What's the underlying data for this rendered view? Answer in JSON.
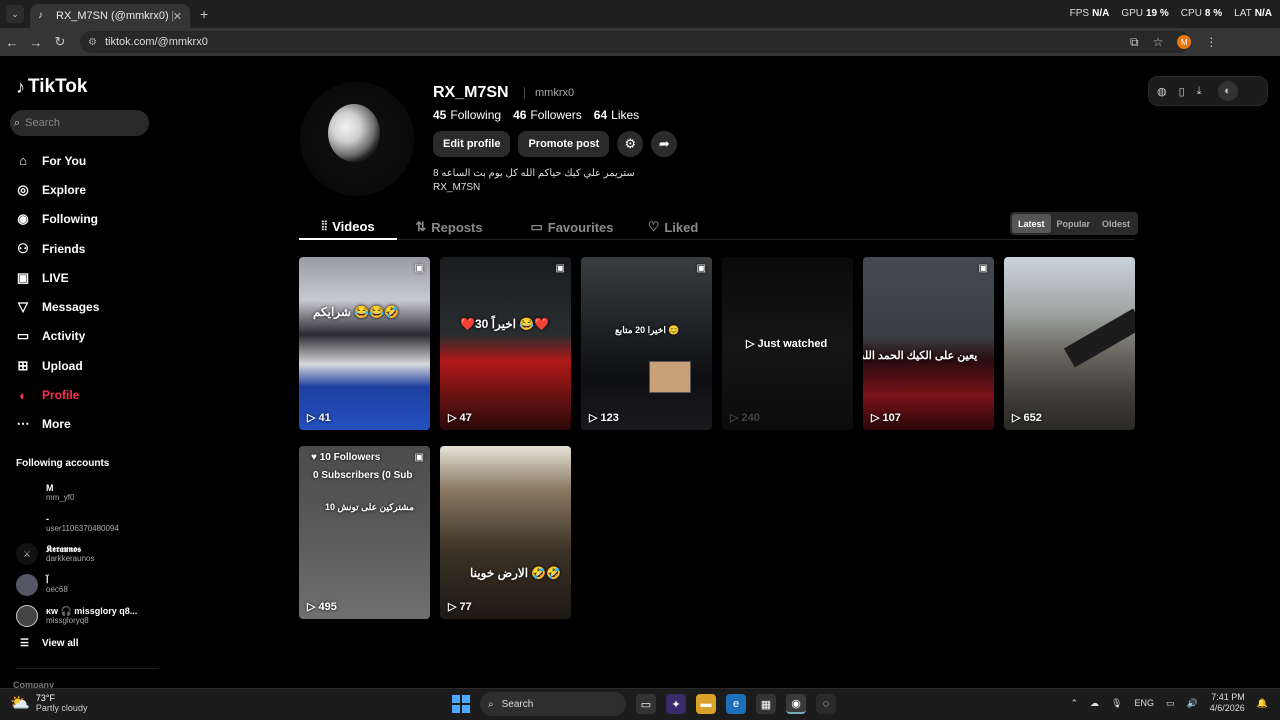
{
  "browser": {
    "tab_title": "RX_M7SN (@mmkrx0) | TikTok",
    "url": "tiktok.com/@mmkrx0",
    "profile_initial": "M",
    "perf": [
      {
        "label": "FPS",
        "value": "N/A"
      },
      {
        "label": "GPU",
        "value": "19 %"
      },
      {
        "label": "CPU",
        "value": "8 %"
      },
      {
        "label": "LAT",
        "value": "N/A"
      }
    ]
  },
  "sidebar": {
    "logo": "TikTok",
    "search_placeholder": "Search",
    "nav": [
      {
        "label": "For You",
        "icon": "home-icon"
      },
      {
        "label": "Explore",
        "icon": "compass-icon"
      },
      {
        "label": "Following",
        "icon": "following-avatar-icon"
      },
      {
        "label": "Friends",
        "icon": "friends-icon"
      },
      {
        "label": "LIVE",
        "icon": "live-icon"
      },
      {
        "label": "Messages",
        "icon": "messages-icon"
      },
      {
        "label": "Activity",
        "icon": "activity-icon"
      },
      {
        "label": "Upload",
        "icon": "upload-icon"
      },
      {
        "label": "Profile",
        "icon": "profile-icon",
        "active": true
      },
      {
        "label": "More",
        "icon": "more-icon"
      }
    ],
    "following_header": "Following accounts",
    "following": [
      {
        "name": "M",
        "handle": "mm_yf0"
      },
      {
        "name": "-",
        "handle": "user1106370480094"
      },
      {
        "name": "𝕶𝖊𝖗𝖆𝖚𝖓𝖔𝖘",
        "handle": "darkkeraunos"
      },
      {
        "name": "آ",
        "handle": "oec68"
      },
      {
        "name": "ᴋᴡ 🎧 missglory q8...",
        "handle": "missgloryq8"
      }
    ],
    "view_all": "View all",
    "company": "Company"
  },
  "profile": {
    "name": "RX_M7SN",
    "handle": "mmkrx0",
    "following_count": "45",
    "following_label": "Following",
    "followers_count": "46",
    "followers_label": "Followers",
    "likes_count": "64",
    "likes_label": "Likes",
    "edit_profile": "Edit profile",
    "promote_post": "Promote post",
    "bio_line1": "ستريمر علي كيك حياكم الله كل يوم بث الساعه 8",
    "bio_line2": "RX_M7SN"
  },
  "tabs": [
    {
      "label": "Videos",
      "icon": "grid-icon",
      "active": true
    },
    {
      "label": "Reposts",
      "icon": "repost-icon"
    },
    {
      "label": "Favourites",
      "icon": "bookmark-icon"
    },
    {
      "label": "Liked",
      "icon": "heart-icon"
    }
  ],
  "sort": [
    "Latest",
    "Popular",
    "Oldest"
  ],
  "sort_selected": "Latest",
  "videos": [
    {
      "views": "41",
      "caption": "شرايكم 😂😂🤣"
    },
    {
      "views": "47",
      "caption": "❤️30 اخيراً 😂❤️"
    },
    {
      "views": "123",
      "caption": "اخيرا 20 متابع 😊"
    },
    {
      "views": "240",
      "overlay": "Just watched"
    },
    {
      "views": "107",
      "caption": "يعين على الكيك الحمد الله"
    },
    {
      "views": "652",
      "caption": ""
    },
    {
      "views": "495",
      "caption": "10 Followers",
      "caption2": "0 Subscribers (0 Sub",
      "caption3": "10 مشتركين على تونش"
    },
    {
      "views": "77",
      "caption": "الارض خوينا 🤣🤣"
    }
  ],
  "taskbar": {
    "temp": "73°F",
    "weather": "Partly cloudy",
    "search": "Search",
    "lang": "ENG",
    "time": "7:41 PM",
    "date": "4/6/2026"
  }
}
